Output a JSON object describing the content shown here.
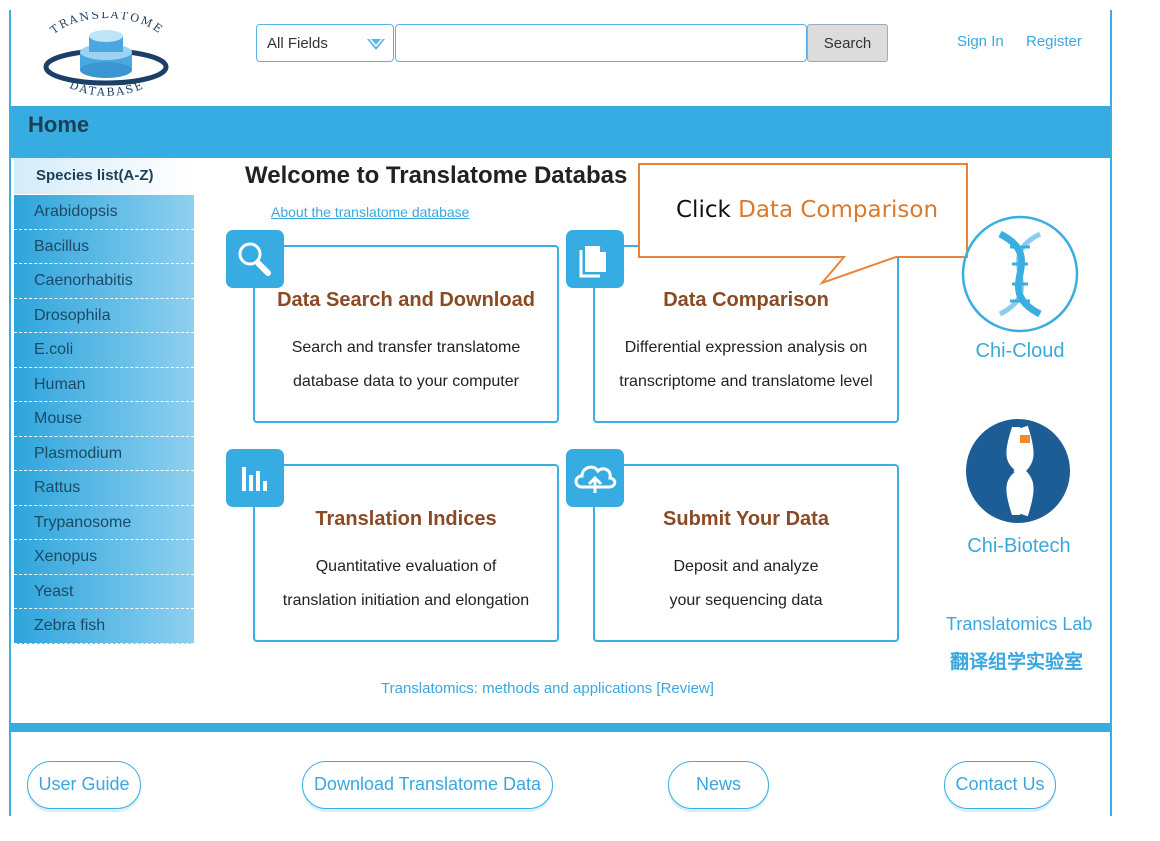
{
  "header": {
    "logo_text_top": "TRANSLATOME",
    "logo_text_bottom": "DATABASE",
    "field_select": "All Fields",
    "search_placeholder": "",
    "search_label": "Search",
    "sign_in": "Sign In",
    "register": "Register"
  },
  "nav": {
    "home": "Home"
  },
  "sidebar": {
    "heading": "Species list(A-Z)",
    "items": [
      "Arabidopsis",
      "Bacillus",
      "Caenorhabitis",
      "Drosophila",
      "E.coli",
      "Human",
      "Mouse",
      "Plasmodium",
      "Rattus",
      "Trypanosome",
      "Xenopus",
      "Yeast",
      "Zebra fish"
    ]
  },
  "main": {
    "welcome": "Welcome to Translatome Databas",
    "about_link": "About the translatome database",
    "cards": [
      {
        "title": "Data Search and Download",
        "line1": "Search and transfer translatome",
        "line2": "database data to your computer",
        "icon": "search-icon"
      },
      {
        "title": "Data Comparison",
        "line1": "Differential expression analysis on",
        "line2": "transcriptome and translatome level",
        "icon": "document-icon"
      },
      {
        "title": "Translation Indices",
        "line1": "Quantitative evaluation of",
        "line2": "translation initiation and elongation",
        "icon": "bar-chart-icon"
      },
      {
        "title": "Submit Your Data",
        "line1": "Deposit and analyze",
        "line2": "your sequencing data",
        "icon": "cloud-upload-icon"
      }
    ],
    "review_link": "Translatomics: methods and applications [Review]"
  },
  "callout": {
    "prefix": "Click ",
    "highlight": "Data Comparison"
  },
  "partners": {
    "chi_cloud": "Chi-Cloud",
    "chi_biotech": "Chi-Biotech",
    "lab_en": "Translatomics Lab",
    "lab_cn": "翻译组学实验室"
  },
  "footer": {
    "user_guide": "User Guide",
    "download": "Download Translatome Data",
    "news": "News",
    "contact": "Contact Us"
  },
  "colors": {
    "accent": "#36ace2",
    "card_title": "#8a4a24",
    "callout_border": "#e8843a",
    "callout_highlight": "#d97a2c"
  }
}
